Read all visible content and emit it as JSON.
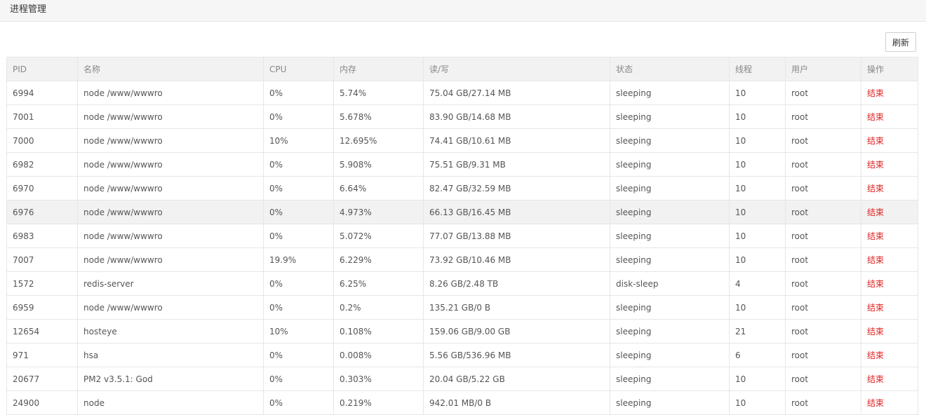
{
  "page": {
    "title": "进程管理",
    "refresh_label": "刷新"
  },
  "table": {
    "headers": {
      "pid": "PID",
      "name": "名称",
      "cpu": "CPU",
      "mem": "内存",
      "io": "读/写",
      "status": "状态",
      "threads": "线程",
      "user": "用户",
      "action": "操作"
    },
    "rows": [
      {
        "pid": "6994",
        "name": "node /www/wwwro",
        "cpu": "0%",
        "mem": "5.74%",
        "io": "75.04 GB/27.14 MB",
        "status": "sleeping",
        "threads": "10",
        "user": "root",
        "action": "结束"
      },
      {
        "pid": "7001",
        "name": "node /www/wwwro",
        "cpu": "0%",
        "mem": "5.678%",
        "io": "83.90 GB/14.68 MB",
        "status": "sleeping",
        "threads": "10",
        "user": "root",
        "action": "结束"
      },
      {
        "pid": "7000",
        "name": "node /www/wwwro",
        "cpu": "10%",
        "mem": "12.695%",
        "io": "74.41 GB/10.61 MB",
        "status": "sleeping",
        "threads": "10",
        "user": "root",
        "action": "结束"
      },
      {
        "pid": "6982",
        "name": "node /www/wwwro",
        "cpu": "0%",
        "mem": "5.908%",
        "io": "75.51 GB/9.31 MB",
        "status": "sleeping",
        "threads": "10",
        "user": "root",
        "action": "结束"
      },
      {
        "pid": "6970",
        "name": "node /www/wwwro",
        "cpu": "0%",
        "mem": "6.64%",
        "io": "82.47 GB/32.59 MB",
        "status": "sleeping",
        "threads": "10",
        "user": "root",
        "action": "结束"
      },
      {
        "pid": "6976",
        "name": "node /www/wwwro",
        "cpu": "0%",
        "mem": "4.973%",
        "io": "66.13 GB/16.45 MB",
        "status": "sleeping",
        "threads": "10",
        "user": "root",
        "action": "结束"
      },
      {
        "pid": "6983",
        "name": "node /www/wwwro",
        "cpu": "0%",
        "mem": "5.072%",
        "io": "77.07 GB/13.88 MB",
        "status": "sleeping",
        "threads": "10",
        "user": "root",
        "action": "结束"
      },
      {
        "pid": "7007",
        "name": "node /www/wwwro",
        "cpu": "19.9%",
        "mem": "6.229%",
        "io": "73.92 GB/10.46 MB",
        "status": "sleeping",
        "threads": "10",
        "user": "root",
        "action": "结束"
      },
      {
        "pid": "1572",
        "name": "redis-server",
        "cpu": "0%",
        "mem": "6.25%",
        "io": "8.26 GB/2.48 TB",
        "status": "disk-sleep",
        "threads": "4",
        "user": "root",
        "action": "结束"
      },
      {
        "pid": "6959",
        "name": "node /www/wwwro",
        "cpu": "0%",
        "mem": "0.2%",
        "io": "135.21 GB/0 B",
        "status": "sleeping",
        "threads": "10",
        "user": "root",
        "action": "结束"
      },
      {
        "pid": "12654",
        "name": "hosteye",
        "cpu": "10%",
        "mem": "0.108%",
        "io": "159.06 GB/9.00 GB",
        "status": "sleeping",
        "threads": "21",
        "user": "root",
        "action": "结束"
      },
      {
        "pid": "971",
        "name": "hsa",
        "cpu": "0%",
        "mem": "0.008%",
        "io": "5.56 GB/536.96 MB",
        "status": "sleeping",
        "threads": "6",
        "user": "root",
        "action": "结束"
      },
      {
        "pid": "20677",
        "name": "PM2 v3.5.1: God",
        "cpu": "0%",
        "mem": "0.303%",
        "io": "20.04 GB/5.22 GB",
        "status": "sleeping",
        "threads": "10",
        "user": "root",
        "action": "结束"
      },
      {
        "pid": "24900",
        "name": "node",
        "cpu": "0%",
        "mem": "0.219%",
        "io": "942.01 MB/0 B",
        "status": "sleeping",
        "threads": "10",
        "user": "root",
        "action": "结束"
      }
    ]
  },
  "colors": {
    "kill_link": "#e02020",
    "header_bg": "#f2f2f2",
    "row_highlight_bg": "#f2f2f2"
  }
}
